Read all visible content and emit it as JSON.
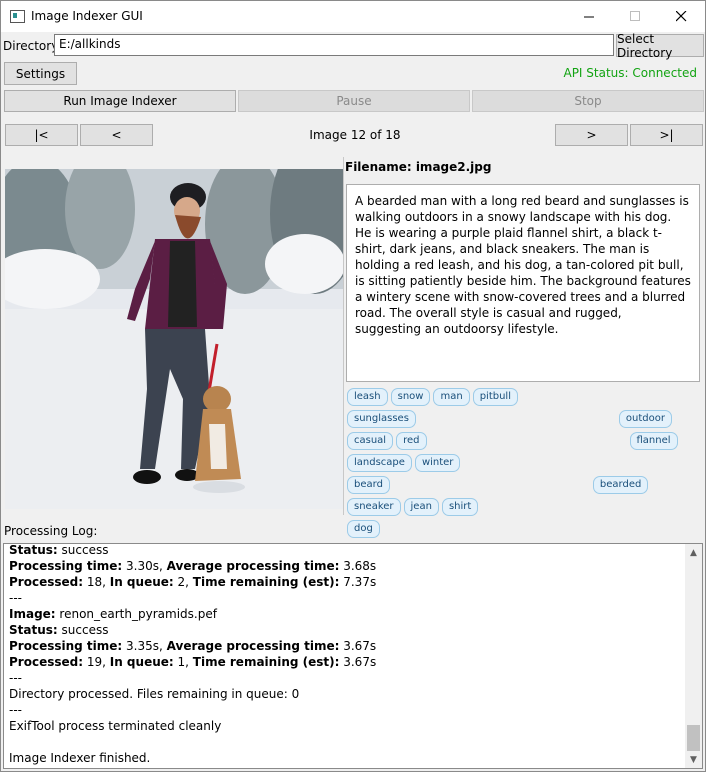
{
  "window": {
    "title": "Image Indexer GUI"
  },
  "directory": {
    "label": "Directory:",
    "value": "E:/allkinds",
    "select_button": "Select Directory"
  },
  "settings_button": "Settings",
  "api_status": "API Status: Connected",
  "colors": {
    "api_status": "#12a312",
    "tag_bg": "#e3f1fb",
    "tag_border": "#9ccbe8"
  },
  "controls": {
    "run": "Run Image Indexer",
    "pause": "Pause",
    "stop": "Stop"
  },
  "pager": {
    "first": "|<",
    "prev": "<",
    "status": "Image 12 of 18",
    "next": ">",
    "last": ">|"
  },
  "detail": {
    "filename_label": "Filename: image2.jpg",
    "description": "A bearded man with a long red beard and sunglasses is walking outdoors in a snowy landscape with his dog. He is wearing a purple plaid flannel shirt, a black t-shirt, dark jeans, and black sneakers. The man is holding a red leash, and his dog, a tan-colored pit bull, is sitting patiently beside him. The background features a wintery scene with snow-covered trees and a blurred road. The overall style is casual and rugged, suggesting an outdoorsy lifestyle.",
    "tags": [
      "leash",
      "snow",
      "man",
      "pitbull",
      "sunglasses",
      "outdoor",
      "casual",
      "red",
      "flannel",
      "landscape",
      "winter",
      "beard",
      "bearded",
      "sneaker",
      "jean",
      "shirt",
      "dog"
    ]
  },
  "log": {
    "label": "Processing Log:",
    "lines": [
      {
        "b1": "Status:",
        "t1": " success"
      },
      {
        "b1": "Processing time:",
        "t1": " 3.30s, ",
        "b2": "Average processing time:",
        "t2": " 3.68s"
      },
      {
        "b1": "Processed:",
        "t1": " 18, ",
        "b2": "In queue:",
        "t2": " 2, ",
        "b3": "Time remaining (est):",
        "t3": " 7.37s"
      },
      {
        "t1": "---"
      },
      {
        "b1": "Image:",
        "t1": " renon_earth_pyramids.pef"
      },
      {
        "b1": "Status:",
        "t1": " success"
      },
      {
        "b1": "Processing time:",
        "t1": " 3.35s, ",
        "b2": "Average processing time:",
        "t2": " 3.67s"
      },
      {
        "b1": "Processed:",
        "t1": " 19, ",
        "b2": "In queue:",
        "t2": " 1, ",
        "b3": "Time remaining (est):",
        "t3": " 3.67s"
      },
      {
        "t1": "---"
      },
      {
        "t1": "Directory processed. Files remaining in queue: 0"
      },
      {
        "t1": "---"
      },
      {
        "t1": "ExifTool process terminated cleanly"
      },
      {
        "t1": ""
      },
      {
        "t1": "Image Indexer finished."
      }
    ]
  }
}
